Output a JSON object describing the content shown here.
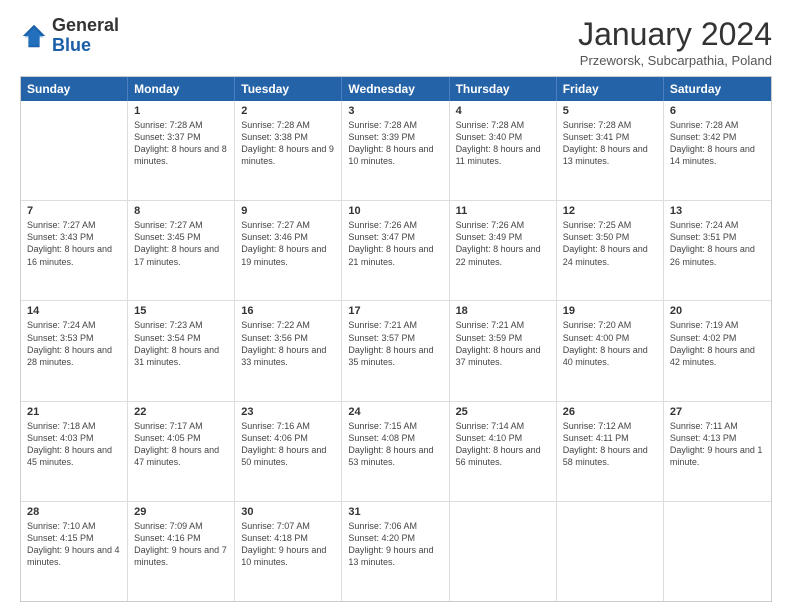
{
  "header": {
    "logo_general": "General",
    "logo_blue": "Blue",
    "month_title": "January 2024",
    "subtitle": "Przeworsk, Subcarpathia, Poland"
  },
  "day_headers": [
    "Sunday",
    "Monday",
    "Tuesday",
    "Wednesday",
    "Thursday",
    "Friday",
    "Saturday"
  ],
  "weeks": [
    [
      {
        "date": "",
        "sunrise": "",
        "sunset": "",
        "daylight": ""
      },
      {
        "date": "1",
        "sunrise": "Sunrise: 7:28 AM",
        "sunset": "Sunset: 3:37 PM",
        "daylight": "Daylight: 8 hours and 8 minutes."
      },
      {
        "date": "2",
        "sunrise": "Sunrise: 7:28 AM",
        "sunset": "Sunset: 3:38 PM",
        "daylight": "Daylight: 8 hours and 9 minutes."
      },
      {
        "date": "3",
        "sunrise": "Sunrise: 7:28 AM",
        "sunset": "Sunset: 3:39 PM",
        "daylight": "Daylight: 8 hours and 10 minutes."
      },
      {
        "date": "4",
        "sunrise": "Sunrise: 7:28 AM",
        "sunset": "Sunset: 3:40 PM",
        "daylight": "Daylight: 8 hours and 11 minutes."
      },
      {
        "date": "5",
        "sunrise": "Sunrise: 7:28 AM",
        "sunset": "Sunset: 3:41 PM",
        "daylight": "Daylight: 8 hours and 13 minutes."
      },
      {
        "date": "6",
        "sunrise": "Sunrise: 7:28 AM",
        "sunset": "Sunset: 3:42 PM",
        "daylight": "Daylight: 8 hours and 14 minutes."
      }
    ],
    [
      {
        "date": "7",
        "sunrise": "Sunrise: 7:27 AM",
        "sunset": "Sunset: 3:43 PM",
        "daylight": "Daylight: 8 hours and 16 minutes."
      },
      {
        "date": "8",
        "sunrise": "Sunrise: 7:27 AM",
        "sunset": "Sunset: 3:45 PM",
        "daylight": "Daylight: 8 hours and 17 minutes."
      },
      {
        "date": "9",
        "sunrise": "Sunrise: 7:27 AM",
        "sunset": "Sunset: 3:46 PM",
        "daylight": "Daylight: 8 hours and 19 minutes."
      },
      {
        "date": "10",
        "sunrise": "Sunrise: 7:26 AM",
        "sunset": "Sunset: 3:47 PM",
        "daylight": "Daylight: 8 hours and 21 minutes."
      },
      {
        "date": "11",
        "sunrise": "Sunrise: 7:26 AM",
        "sunset": "Sunset: 3:49 PM",
        "daylight": "Daylight: 8 hours and 22 minutes."
      },
      {
        "date": "12",
        "sunrise": "Sunrise: 7:25 AM",
        "sunset": "Sunset: 3:50 PM",
        "daylight": "Daylight: 8 hours and 24 minutes."
      },
      {
        "date": "13",
        "sunrise": "Sunrise: 7:24 AM",
        "sunset": "Sunset: 3:51 PM",
        "daylight": "Daylight: 8 hours and 26 minutes."
      }
    ],
    [
      {
        "date": "14",
        "sunrise": "Sunrise: 7:24 AM",
        "sunset": "Sunset: 3:53 PM",
        "daylight": "Daylight: 8 hours and 28 minutes."
      },
      {
        "date": "15",
        "sunrise": "Sunrise: 7:23 AM",
        "sunset": "Sunset: 3:54 PM",
        "daylight": "Daylight: 8 hours and 31 minutes."
      },
      {
        "date": "16",
        "sunrise": "Sunrise: 7:22 AM",
        "sunset": "Sunset: 3:56 PM",
        "daylight": "Daylight: 8 hours and 33 minutes."
      },
      {
        "date": "17",
        "sunrise": "Sunrise: 7:21 AM",
        "sunset": "Sunset: 3:57 PM",
        "daylight": "Daylight: 8 hours and 35 minutes."
      },
      {
        "date": "18",
        "sunrise": "Sunrise: 7:21 AM",
        "sunset": "Sunset: 3:59 PM",
        "daylight": "Daylight: 8 hours and 37 minutes."
      },
      {
        "date": "19",
        "sunrise": "Sunrise: 7:20 AM",
        "sunset": "Sunset: 4:00 PM",
        "daylight": "Daylight: 8 hours and 40 minutes."
      },
      {
        "date": "20",
        "sunrise": "Sunrise: 7:19 AM",
        "sunset": "Sunset: 4:02 PM",
        "daylight": "Daylight: 8 hours and 42 minutes."
      }
    ],
    [
      {
        "date": "21",
        "sunrise": "Sunrise: 7:18 AM",
        "sunset": "Sunset: 4:03 PM",
        "daylight": "Daylight: 8 hours and 45 minutes."
      },
      {
        "date": "22",
        "sunrise": "Sunrise: 7:17 AM",
        "sunset": "Sunset: 4:05 PM",
        "daylight": "Daylight: 8 hours and 47 minutes."
      },
      {
        "date": "23",
        "sunrise": "Sunrise: 7:16 AM",
        "sunset": "Sunset: 4:06 PM",
        "daylight": "Daylight: 8 hours and 50 minutes."
      },
      {
        "date": "24",
        "sunrise": "Sunrise: 7:15 AM",
        "sunset": "Sunset: 4:08 PM",
        "daylight": "Daylight: 8 hours and 53 minutes."
      },
      {
        "date": "25",
        "sunrise": "Sunrise: 7:14 AM",
        "sunset": "Sunset: 4:10 PM",
        "daylight": "Daylight: 8 hours and 56 minutes."
      },
      {
        "date": "26",
        "sunrise": "Sunrise: 7:12 AM",
        "sunset": "Sunset: 4:11 PM",
        "daylight": "Daylight: 8 hours and 58 minutes."
      },
      {
        "date": "27",
        "sunrise": "Sunrise: 7:11 AM",
        "sunset": "Sunset: 4:13 PM",
        "daylight": "Daylight: 9 hours and 1 minute."
      }
    ],
    [
      {
        "date": "28",
        "sunrise": "Sunrise: 7:10 AM",
        "sunset": "Sunset: 4:15 PM",
        "daylight": "Daylight: 9 hours and 4 minutes."
      },
      {
        "date": "29",
        "sunrise": "Sunrise: 7:09 AM",
        "sunset": "Sunset: 4:16 PM",
        "daylight": "Daylight: 9 hours and 7 minutes."
      },
      {
        "date": "30",
        "sunrise": "Sunrise: 7:07 AM",
        "sunset": "Sunset: 4:18 PM",
        "daylight": "Daylight: 9 hours and 10 minutes."
      },
      {
        "date": "31",
        "sunrise": "Sunrise: 7:06 AM",
        "sunset": "Sunset: 4:20 PM",
        "daylight": "Daylight: 9 hours and 13 minutes."
      },
      {
        "date": "",
        "sunrise": "",
        "sunset": "",
        "daylight": ""
      },
      {
        "date": "",
        "sunrise": "",
        "sunset": "",
        "daylight": ""
      },
      {
        "date": "",
        "sunrise": "",
        "sunset": "",
        "daylight": ""
      }
    ]
  ]
}
